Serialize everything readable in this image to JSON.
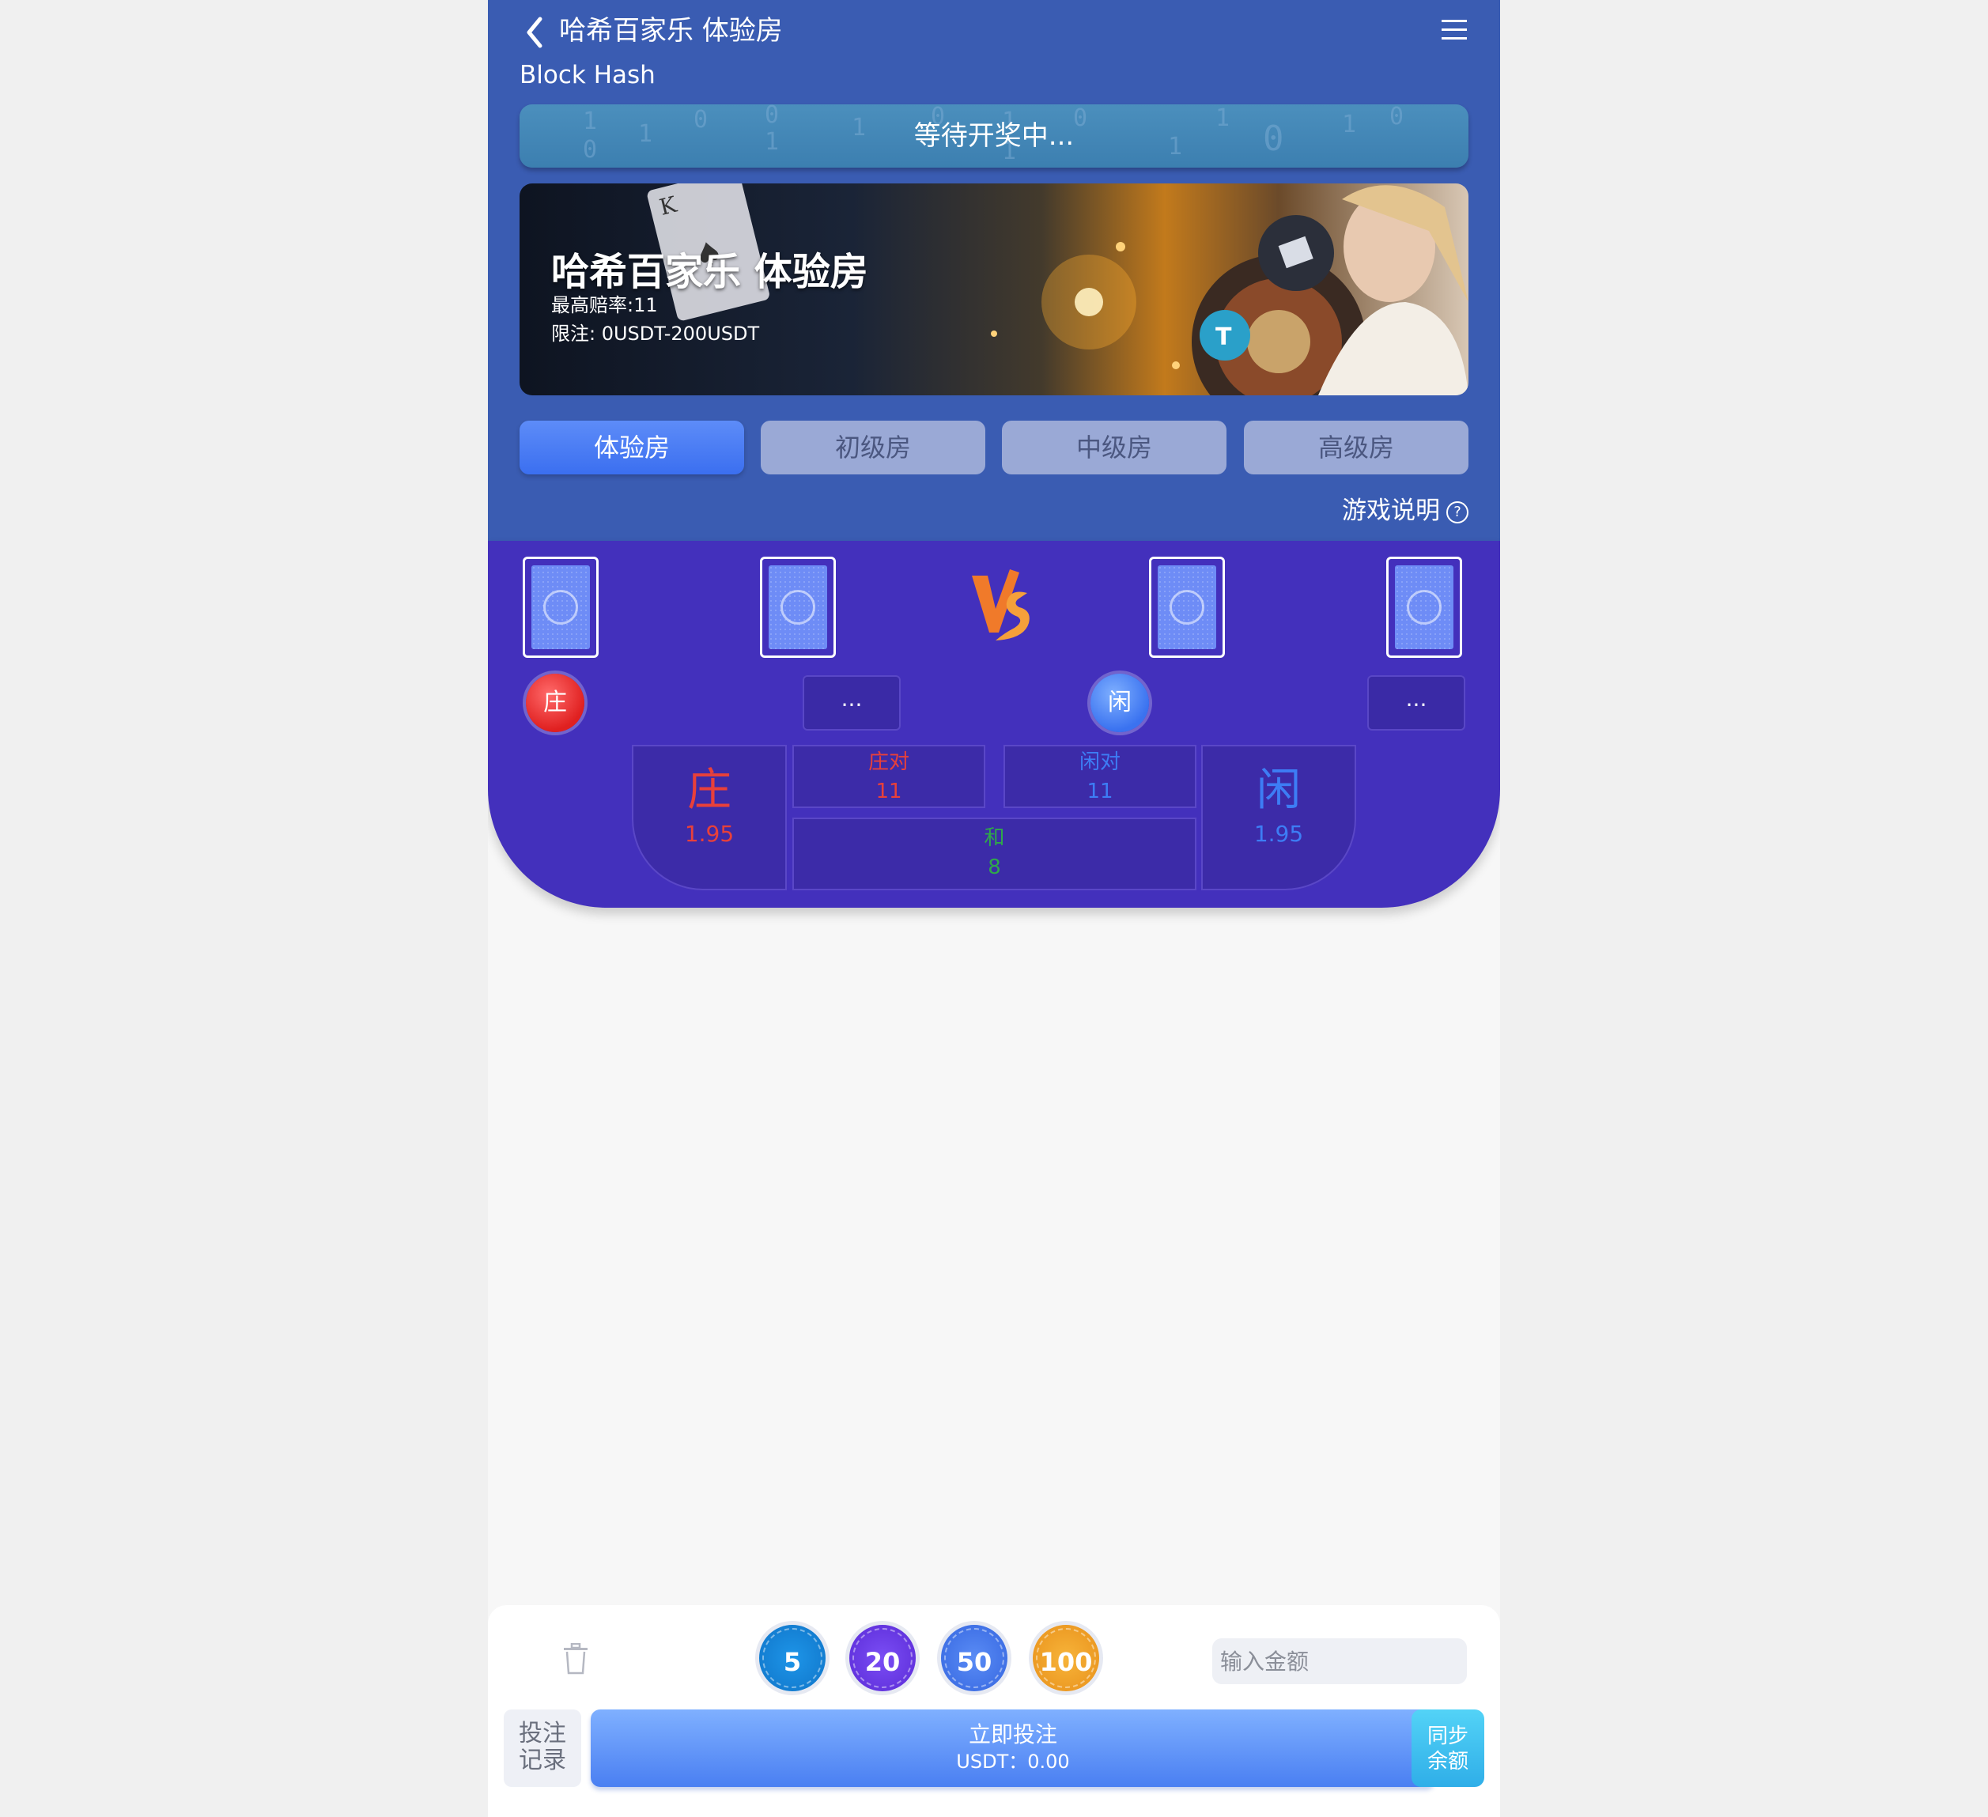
{
  "header": {
    "title": "哈希百家乐 体验房",
    "subtitle": "Block Hash",
    "status": "等待开奖中..."
  },
  "banner": {
    "title": "哈希百家乐 体验房",
    "max_odds": "最高赔率:11",
    "limit": "限注:  0USDT-200USDT"
  },
  "tabs": [
    {
      "label": "体验房",
      "active": true
    },
    {
      "label": "初级房",
      "active": false
    },
    {
      "label": "中级房",
      "active": false
    },
    {
      "label": "高级房",
      "active": false
    }
  ],
  "rules_link": "游戏说明",
  "table": {
    "banker_badge": "庄",
    "player_badge": "闲",
    "banker_result": "...",
    "player_result": "...",
    "bets": {
      "banker": {
        "name": "庄",
        "odds": "1.95"
      },
      "banker_pair": {
        "name": "庄对",
        "odds": "11"
      },
      "player_pair": {
        "name": "闲对",
        "odds": "11"
      },
      "player": {
        "name": "闲",
        "odds": "1.95"
      },
      "tie": {
        "name": "和",
        "odds": "8"
      }
    }
  },
  "bottom": {
    "chips": [
      "5",
      "20",
      "50",
      "100"
    ],
    "amount_placeholder": "输入金额",
    "record_label": "投注记录",
    "bet_now": "立即投注",
    "balance": "USDT：0.00",
    "sync_label": "同步余额"
  },
  "colors": {
    "header_bg": "#3a5cb2",
    "table_bg": "#4330bc",
    "banker_red": "#e8403a",
    "player_blue": "#3d7df5",
    "tie_green": "#2fa84a",
    "chip_5": "#1683d8",
    "chip_20": "#6a3cf0",
    "chip_50": "#3f78ee",
    "chip_100": "#f0a021"
  }
}
